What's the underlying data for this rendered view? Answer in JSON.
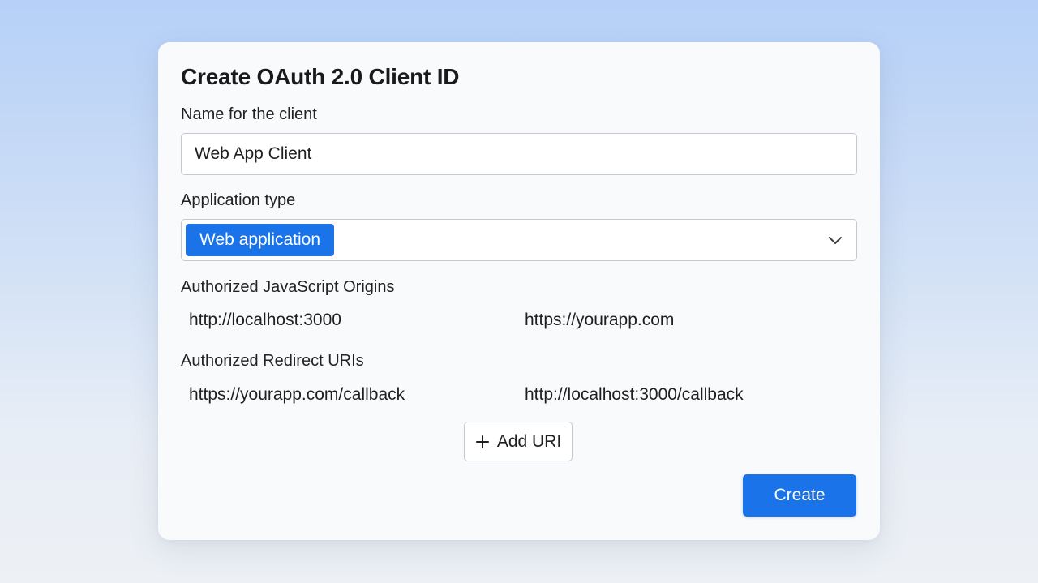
{
  "dialog": {
    "title": "Create OAuth 2.0 Client ID",
    "name_field": {
      "label": "Name for the client",
      "value": "Web App Client"
    },
    "app_type": {
      "label": "Application type",
      "selected": "Web application",
      "icon": "chevron-down-icon"
    },
    "js_origins": {
      "label": "Authorized JavaScript Origins",
      "items": [
        "http://localhost:3000",
        "https://yourapp.com"
      ]
    },
    "redirect_uris": {
      "label": "Authorized Redirect URIs",
      "items": [
        "https://yourapp.com/callback",
        "http://localhost:3000/callback"
      ]
    },
    "add_uri_button": {
      "label": "Add URI",
      "icon": "plus-icon"
    },
    "create_button": {
      "label": "Create"
    }
  },
  "colors": {
    "accent": "#1a73e8",
    "dialog_bg": "#f9fafb",
    "border": "#c5c9cf"
  }
}
